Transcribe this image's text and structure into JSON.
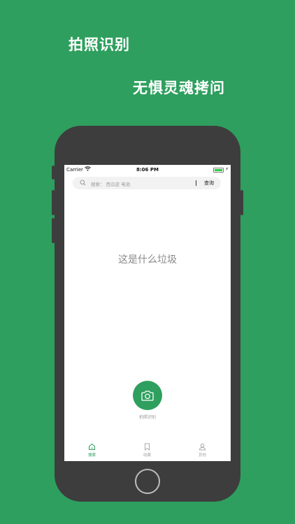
{
  "promo": {
    "line1": "拍照识别",
    "line2": "无惧灵魂拷问"
  },
  "status_bar": {
    "carrier": "Carrier",
    "time": "8:06 PM"
  },
  "search": {
    "placeholder": "搜索：  西瓜皮 电池",
    "button_label": "查询"
  },
  "main": {
    "prompt": "这是什么垃圾"
  },
  "camera": {
    "label": "拍照识别",
    "icon": "camera-icon"
  },
  "tabbar": {
    "tabs": [
      {
        "label": "搜索",
        "icon": "home-icon",
        "active": true
      },
      {
        "label": "收藏",
        "icon": "bookmark-icon",
        "active": false
      },
      {
        "label": "其他",
        "icon": "person-icon",
        "active": false
      }
    ]
  },
  "colors": {
    "brand_green": "#2e9f5e",
    "phone_frame": "#3d3d3d",
    "text_gray": "#8a8a8a"
  }
}
